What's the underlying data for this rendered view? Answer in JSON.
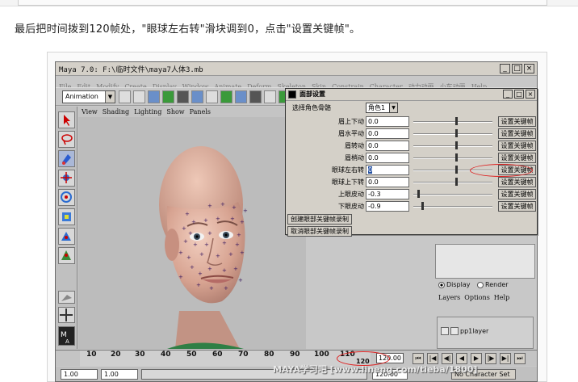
{
  "caption": "最后把时间拨到120帧处，\"眼球左右转\"滑块调到0，点击\"设置关键帧\"。",
  "maya": {
    "title": "Maya 7.0: F:\\临时文件\\maya7人体3.mb",
    "window_buttons": [
      "_",
      "□",
      "×"
    ],
    "menus": [
      "File",
      "Edit",
      "Modify",
      "Create",
      "Display",
      "Window",
      "Animate",
      "Deform",
      "Skeleton",
      "Skin",
      "Constrain",
      "Character",
      "动力动画",
      "小车动画",
      "Help"
    ],
    "mode": "Animation",
    "viewport_menus": [
      "View",
      "Shading",
      "Lighting",
      "Show",
      "Panels"
    ],
    "channel": {
      "display_label": "Display",
      "render_label": "Render",
      "layer_menus": [
        "Layers",
        "Options",
        "Help"
      ],
      "layer_name": "pp1layer"
    },
    "timeline": {
      "ticks": [
        "10",
        "20",
        "30",
        "40",
        "50",
        "60",
        "70",
        "80",
        "90",
        "100",
        "110",
        "120"
      ],
      "current_frame": "120.00",
      "playback": [
        "⏮",
        "|◀",
        "◀|",
        "◀",
        "▶",
        "|▶",
        "▶|",
        "⏭"
      ]
    },
    "range": {
      "start": "1.00",
      "end_start": "1.00",
      "end": "120.00",
      "character_set": "No Character Set"
    }
  },
  "dialog": {
    "title": "面部设置",
    "role_label": "选择角色骨骼",
    "role_value": "角色1",
    "key_button": "设置关键帧",
    "params": [
      {
        "label": "眉上下动",
        "value": "0.0",
        "knob": 0.55
      },
      {
        "label": "眉水平动",
        "value": "0.0",
        "knob": 0.55
      },
      {
        "label": "眉转动",
        "value": "0.0",
        "knob": 0.55
      },
      {
        "label": "眉梢动",
        "value": "0.0",
        "knob": 0.55
      },
      {
        "label": "眼球左右转",
        "value": "0",
        "knob": 0.55
      },
      {
        "label": "眼球上下转",
        "value": "0.0",
        "knob": 0.55
      },
      {
        "label": "上眼皮动",
        "value": "-0.3",
        "knob": 0.05
      },
      {
        "label": "下眼皮动",
        "value": "-0.9",
        "knob": 0.1
      }
    ],
    "create_button": "创建眼部关键帧录制",
    "cancel_button": "取消眼部关键帧录制"
  },
  "watermark": "MAYA学习吧 [www.lineng.com/tieba/1800]"
}
